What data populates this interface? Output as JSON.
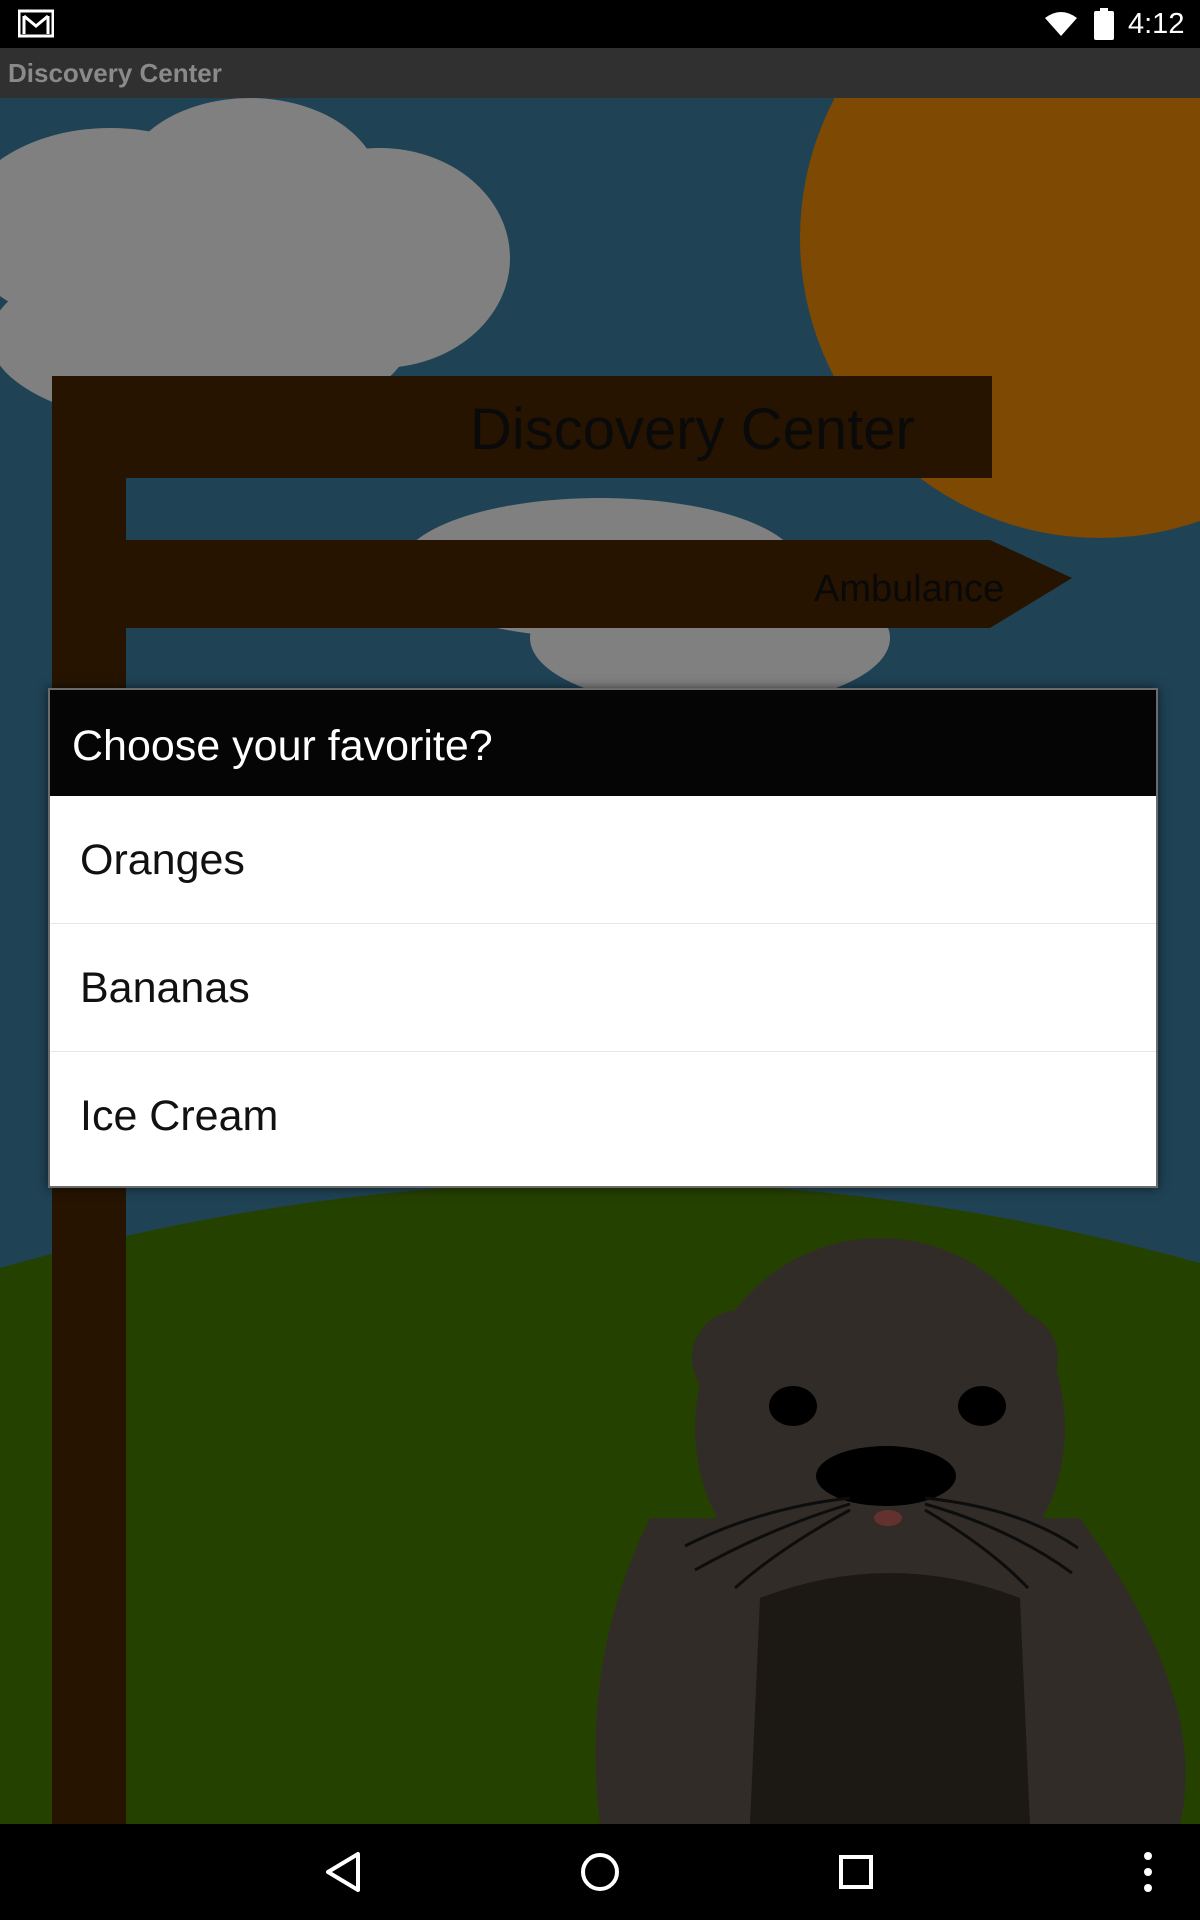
{
  "status_bar": {
    "time": "4:12",
    "icons": [
      "gmail-icon",
      "wifi-icon",
      "battery-icon"
    ]
  },
  "title_bar": {
    "title": "Discovery Center"
  },
  "scene": {
    "sign_main": "Discovery Center",
    "sign_ambulance": "Ambulance",
    "colors": {
      "sky": "#326b89",
      "sun": "#cc7706",
      "grass": "#3c6a00",
      "sign_wood": "#3e2100",
      "otter": "#4f4840"
    }
  },
  "dialog": {
    "title": "Choose your favorite?",
    "options": [
      "Oranges",
      "Bananas",
      "Ice Cream"
    ]
  },
  "nav_bar": {
    "icons": [
      "back-icon",
      "home-icon",
      "recents-icon",
      "overflow-menu-icon"
    ]
  }
}
